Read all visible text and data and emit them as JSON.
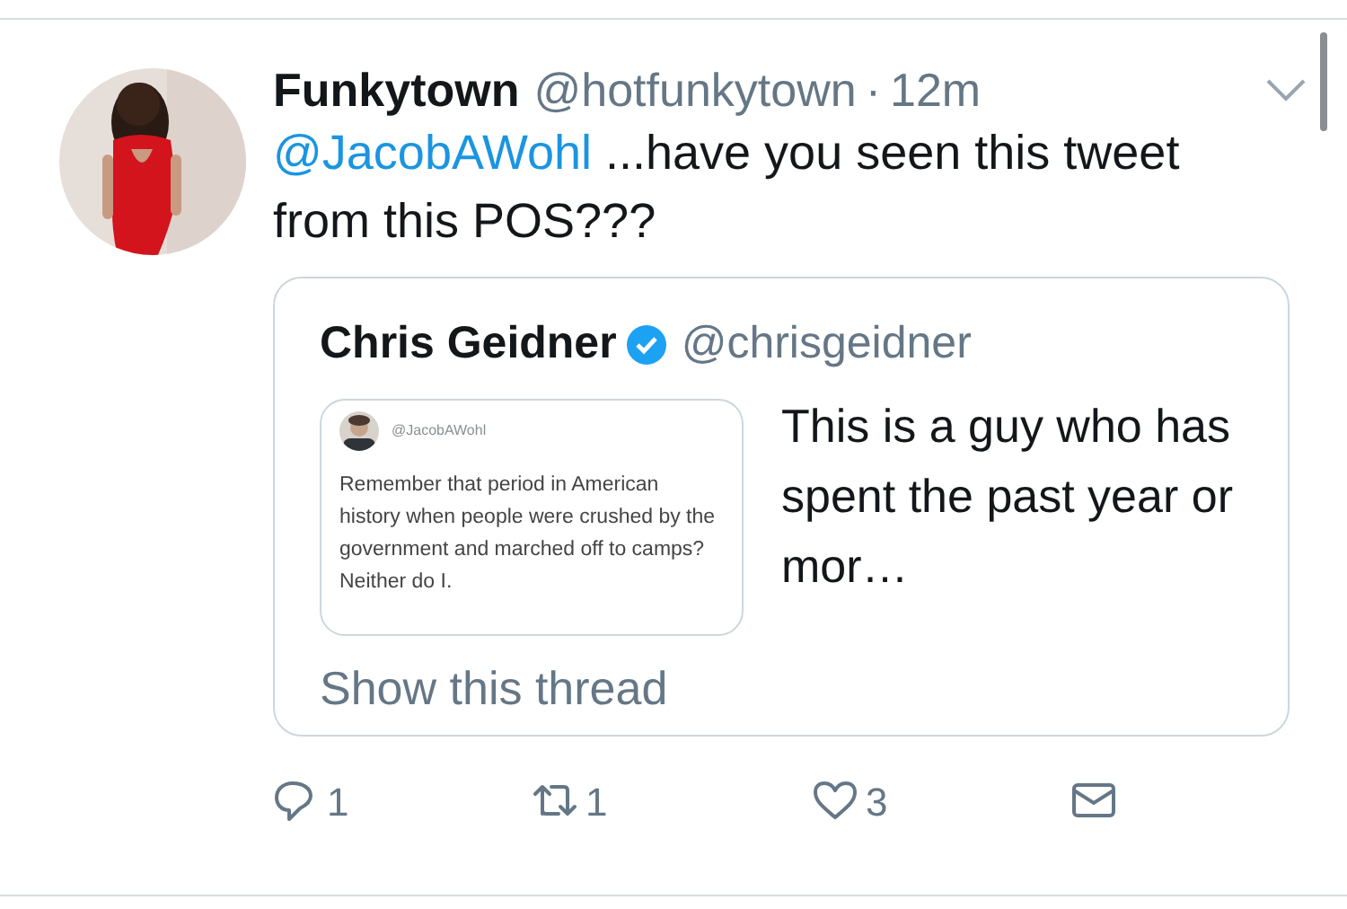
{
  "tweet": {
    "name": "Funkytown",
    "handle": "@hotfunkytown",
    "separator": "·",
    "time": "12m",
    "mention": "@JacobAWohl",
    "text": " ...have you seen this tweet from this POS???"
  },
  "quote": {
    "name": "Chris Geidner",
    "verified": true,
    "handle": "@chrisgeidner",
    "text": "This is a guy who has spent the past year or mor…",
    "link": "Show this thread",
    "embedded": {
      "handle": "@JacobAWohl",
      "text": "Remember that period in American history when people were crushed by the government and marched off to camps? Neither do I."
    }
  },
  "actions": [
    {
      "kind": "reply",
      "count": "1"
    },
    {
      "kind": "retweet",
      "count": "1"
    },
    {
      "kind": "like",
      "count": "3"
    },
    {
      "kind": "message"
    }
  ]
}
